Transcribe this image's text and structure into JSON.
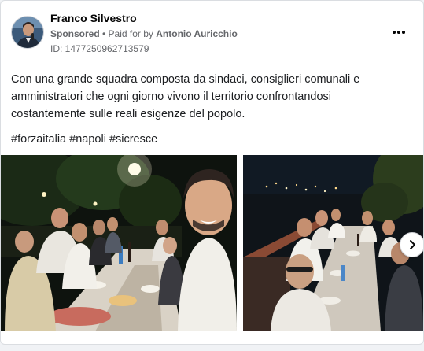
{
  "post": {
    "author": "Franco Silvestro",
    "sponsored_label": "Sponsored",
    "separator": " • ",
    "paid_for_prefix": "Paid for by ",
    "payer": "Antonio Auricchio",
    "ad_id": "ID: 1477250962713579",
    "body_text": "Con una grande squadra composta da sindaci, consiglieri comunali e amministratori che ogni giorno vivono il territorio confrontandosi costantemente sulle reali esigenze del popolo.",
    "hashtags": "#forzaitalia #napoli #sicresce"
  },
  "icons": {
    "more": "more-horizontal-icon",
    "next": "chevron-right-icon"
  },
  "colors": {
    "primary_text": "#050505",
    "secondary_text": "#65676b",
    "card_border": "#dadde1"
  }
}
